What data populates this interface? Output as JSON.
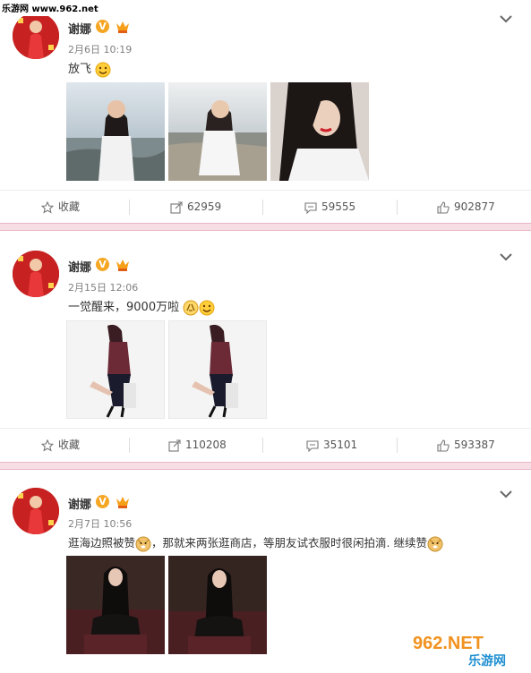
{
  "watermark_top": "乐游网 www.962.net",
  "watermark_bottom": {
    "domain": "962.NET",
    "brand": "乐游网"
  },
  "posts": [
    {
      "author": "谢娜",
      "verified_badge": "V",
      "time": "2月6日 10:19",
      "text": "放飞",
      "emojis": [
        "smile-emoji"
      ],
      "actions": {
        "favorite": "收藏",
        "repost": "62959",
        "comment": "59555",
        "like": "902877"
      }
    },
    {
      "author": "谢娜",
      "verified_badge": "V",
      "time": "2月15日 12:06",
      "text": "一觉醒来，9000万啦",
      "emojis": [
        "clap-emoji",
        "smile-emoji"
      ],
      "actions": {
        "favorite": "收藏",
        "repost": "110208",
        "comment": "35101",
        "like": "593387"
      }
    },
    {
      "author": "谢娜",
      "verified_badge": "V",
      "time": "2月7日 10:56",
      "text_part1": "逛海边照被赞",
      "text_part2": "，那就来两张逛商店，等朋友试衣服时很闲拍滴. 继续赞",
      "emojis": [
        "doge-emoji",
        "doge-emoji"
      ]
    }
  ],
  "colors": {
    "accent_orange": "#f5a623",
    "separator_pink": "#f7dde4",
    "avatar_red": "#c41d1d"
  }
}
